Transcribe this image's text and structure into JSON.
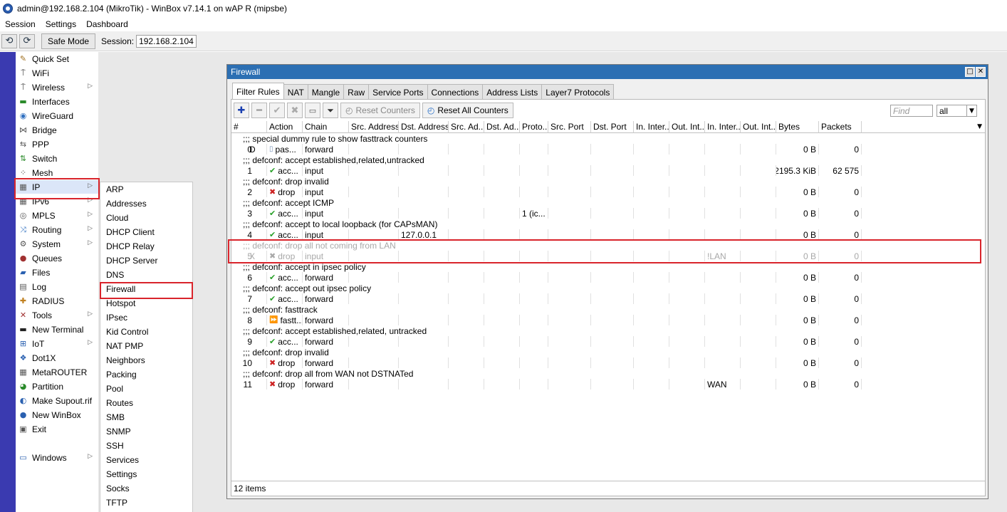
{
  "window_title": "admin@192.168.2.104 (MikroTik) - WinBox v7.14.1 on wAP R (mipsbe)",
  "menubar": [
    "Session",
    "Settings",
    "Dashboard"
  ],
  "toolbar": {
    "undo": "⟲",
    "redo": "⟳",
    "safe_mode": "Safe Mode",
    "session_label": "Session:",
    "session_value": "192.168.2.104"
  },
  "left_menu": [
    {
      "label": "Quick Set",
      "icon": "wand-icon",
      "g": "✎",
      "c": "#a07020",
      "arrow": false
    },
    {
      "label": "WiFi",
      "icon": "wifi-icon",
      "g": "⍑",
      "c": "#333",
      "arrow": false
    },
    {
      "label": "Wireless",
      "icon": "wireless-icon",
      "g": "⍑",
      "c": "#333",
      "arrow": true
    },
    {
      "label": "Interfaces",
      "icon": "interfaces-icon",
      "g": "▬",
      "c": "#2a8a2a",
      "arrow": false
    },
    {
      "label": "WireGuard",
      "icon": "wireguard-icon",
      "g": "◉",
      "c": "#3070c0",
      "arrow": false
    },
    {
      "label": "Bridge",
      "icon": "bridge-icon",
      "g": "⋈",
      "c": "#555",
      "arrow": false
    },
    {
      "label": "PPP",
      "icon": "ppp-icon",
      "g": "⇆",
      "c": "#555",
      "arrow": false
    },
    {
      "label": "Switch",
      "icon": "switch-icon",
      "g": "⇅",
      "c": "#2a8a2a",
      "arrow": false
    },
    {
      "label": "Mesh",
      "icon": "mesh-icon",
      "g": "⁘",
      "c": "#333",
      "arrow": false
    },
    {
      "label": "IP",
      "icon": "ip-icon",
      "g": "▦",
      "c": "#555",
      "arrow": true
    },
    {
      "label": "IPv6",
      "icon": "ipv6-icon",
      "g": "▦",
      "c": "#555",
      "arrow": true
    },
    {
      "label": "MPLS",
      "icon": "mpls-icon",
      "g": "◎",
      "c": "#555",
      "arrow": true
    },
    {
      "label": "Routing",
      "icon": "routing-icon",
      "g": "⤨",
      "c": "#3070c0",
      "arrow": true
    },
    {
      "label": "System",
      "icon": "system-icon",
      "g": "⚙",
      "c": "#555",
      "arrow": true
    },
    {
      "label": "Queues",
      "icon": "queues-icon",
      "g": "●",
      "c": "#a03030",
      "arrow": false
    },
    {
      "label": "Files",
      "icon": "files-icon",
      "g": "▰",
      "c": "#2a60b0",
      "arrow": false
    },
    {
      "label": "Log",
      "icon": "log-icon",
      "g": "▤",
      "c": "#555",
      "arrow": false
    },
    {
      "label": "RADIUS",
      "icon": "radius-icon",
      "g": "✚",
      "c": "#c08020",
      "arrow": false
    },
    {
      "label": "Tools",
      "icon": "tools-icon",
      "g": "✕",
      "c": "#a03030",
      "arrow": true
    },
    {
      "label": "New Terminal",
      "icon": "terminal-icon",
      "g": "▬",
      "c": "#222",
      "arrow": false
    },
    {
      "label": "IoT",
      "icon": "iot-icon",
      "g": "⊞",
      "c": "#2a60b0",
      "arrow": true
    },
    {
      "label": "Dot1X",
      "icon": "dot1x-icon",
      "g": "❖",
      "c": "#2a60b0",
      "arrow": false
    },
    {
      "label": "MetaROUTER",
      "icon": "metarouter-icon",
      "g": "▦",
      "c": "#555",
      "arrow": false
    },
    {
      "label": "Partition",
      "icon": "partition-icon",
      "g": "◕",
      "c": "#2a8a2a",
      "arrow": false
    },
    {
      "label": "Make Supout.rif",
      "icon": "supout-icon",
      "g": "◐",
      "c": "#2a60b0",
      "arrow": false
    },
    {
      "label": "New WinBox",
      "icon": "winbox-icon",
      "g": "●",
      "c": "#2a60b0",
      "arrow": false
    },
    {
      "label": "Exit",
      "icon": "exit-icon",
      "g": "▣",
      "c": "#555",
      "arrow": false
    },
    {
      "label": "",
      "icon": "",
      "g": "",
      "c": "",
      "arrow": false
    },
    {
      "label": "Windows",
      "icon": "windows-icon",
      "g": "▭",
      "c": "#2a60b0",
      "arrow": true
    }
  ],
  "ip_submenu": [
    "ARP",
    "Addresses",
    "Cloud",
    "DHCP Client",
    "DHCP Relay",
    "DHCP Server",
    "DNS",
    "Firewall",
    "Hotspot",
    "IPsec",
    "Kid Control",
    "NAT PMP",
    "Neighbors",
    "Packing",
    "Pool",
    "Routes",
    "SMB",
    "SNMP",
    "SSH",
    "Services",
    "Settings",
    "Socks",
    "TFTP"
  ],
  "firewall": {
    "title": "Firewall",
    "tabs": [
      "Filter Rules",
      "NAT",
      "Mangle",
      "Raw",
      "Service Ports",
      "Connections",
      "Address Lists",
      "Layer7 Protocols"
    ],
    "reset_counters": "Reset Counters",
    "reset_all_counters": "Reset All Counters",
    "find_placeholder": "Find",
    "filter_value": "all",
    "columns": [
      "#",
      "Action",
      "Chain",
      "Src. Address",
      "Dst. Address",
      "Src. Ad...",
      "Dst. Ad...",
      "Proto...",
      "Src. Port",
      "Dst. Port",
      "In. Inter...",
      "Out. Int...",
      "In. Inter...",
      "Out. Int...",
      "Bytes",
      "Packets"
    ],
    "rows": [
      {
        "type": "comment",
        "text": ";;; special dummy rule to show fasttrack counters"
      },
      {
        "type": "rule",
        "num": "0",
        "flag": "D",
        "icon": "pass",
        "action": "pas...",
        "chain": "forward",
        "dst": "",
        "proto": "",
        "inlist": "",
        "bytes": "0 B",
        "packets": "0"
      },
      {
        "type": "comment",
        "text": ";;; defconf: accept established,related,untracked"
      },
      {
        "type": "rule",
        "num": "1",
        "flag": "",
        "icon": "ok",
        "action": "acc...",
        "chain": "input",
        "dst": "",
        "proto": "",
        "inlist": "",
        "bytes": "2195.3 KiB",
        "packets": "62 575"
      },
      {
        "type": "comment",
        "text": ";;; defconf: drop invalid"
      },
      {
        "type": "rule",
        "num": "2",
        "flag": "",
        "icon": "x",
        "action": "drop",
        "chain": "input",
        "dst": "",
        "proto": "",
        "inlist": "",
        "bytes": "0 B",
        "packets": "0"
      },
      {
        "type": "comment",
        "text": ";;; defconf: accept ICMP"
      },
      {
        "type": "rule",
        "num": "3",
        "flag": "",
        "icon": "ok",
        "action": "acc...",
        "chain": "input",
        "dst": "",
        "proto": "1 (ic...",
        "inlist": "",
        "bytes": "0 B",
        "packets": "0"
      },
      {
        "type": "comment",
        "text": ";;; defconf: accept to local loopback (for CAPsMAN)"
      },
      {
        "type": "rule",
        "num": "4",
        "flag": "",
        "icon": "ok",
        "action": "acc...",
        "chain": "input",
        "dst": "127.0.0.1",
        "proto": "",
        "inlist": "",
        "bytes": "0 B",
        "packets": "0"
      },
      {
        "type": "comment",
        "text": ";;; defconf: drop all not coming from LAN",
        "disabled": true
      },
      {
        "type": "rule",
        "num": "5",
        "flag": "X",
        "icon": "xd",
        "action": "drop",
        "chain": "input",
        "dst": "",
        "proto": "",
        "inlist": "!LAN",
        "bytes": "0 B",
        "packets": "0",
        "disabled": true
      },
      {
        "type": "comment",
        "text": ";;; defconf: accept in ipsec policy"
      },
      {
        "type": "rule",
        "num": "6",
        "flag": "",
        "icon": "ok",
        "action": "acc...",
        "chain": "forward",
        "dst": "",
        "proto": "",
        "inlist": "",
        "bytes": "0 B",
        "packets": "0"
      },
      {
        "type": "comment",
        "text": ";;; defconf: accept out ipsec policy"
      },
      {
        "type": "rule",
        "num": "7",
        "flag": "",
        "icon": "ok",
        "action": "acc...",
        "chain": "forward",
        "dst": "",
        "proto": "",
        "inlist": "",
        "bytes": "0 B",
        "packets": "0"
      },
      {
        "type": "comment",
        "text": ";;; defconf: fasttrack"
      },
      {
        "type": "rule",
        "num": "8",
        "flag": "",
        "icon": "ft",
        "action": "fastt...",
        "chain": "forward",
        "dst": "",
        "proto": "",
        "inlist": "",
        "bytes": "0 B",
        "packets": "0"
      },
      {
        "type": "comment",
        "text": ";;; defconf: accept established,related, untracked"
      },
      {
        "type": "rule",
        "num": "9",
        "flag": "",
        "icon": "ok",
        "action": "acc...",
        "chain": "forward",
        "dst": "",
        "proto": "",
        "inlist": "",
        "bytes": "0 B",
        "packets": "0"
      },
      {
        "type": "comment",
        "text": ";;; defconf: drop invalid"
      },
      {
        "type": "rule",
        "num": "10",
        "flag": "",
        "icon": "x",
        "action": "drop",
        "chain": "forward",
        "dst": "",
        "proto": "",
        "inlist": "",
        "bytes": "0 B",
        "packets": "0"
      },
      {
        "type": "comment",
        "text": ";;; defconf: drop all from WAN not DSTNATed"
      },
      {
        "type": "rule",
        "num": "11",
        "flag": "",
        "icon": "x",
        "action": "drop",
        "chain": "forward",
        "dst": "",
        "proto": "",
        "inlist": "WAN",
        "bytes": "0 B",
        "packets": "0"
      }
    ],
    "status": "12 items"
  }
}
